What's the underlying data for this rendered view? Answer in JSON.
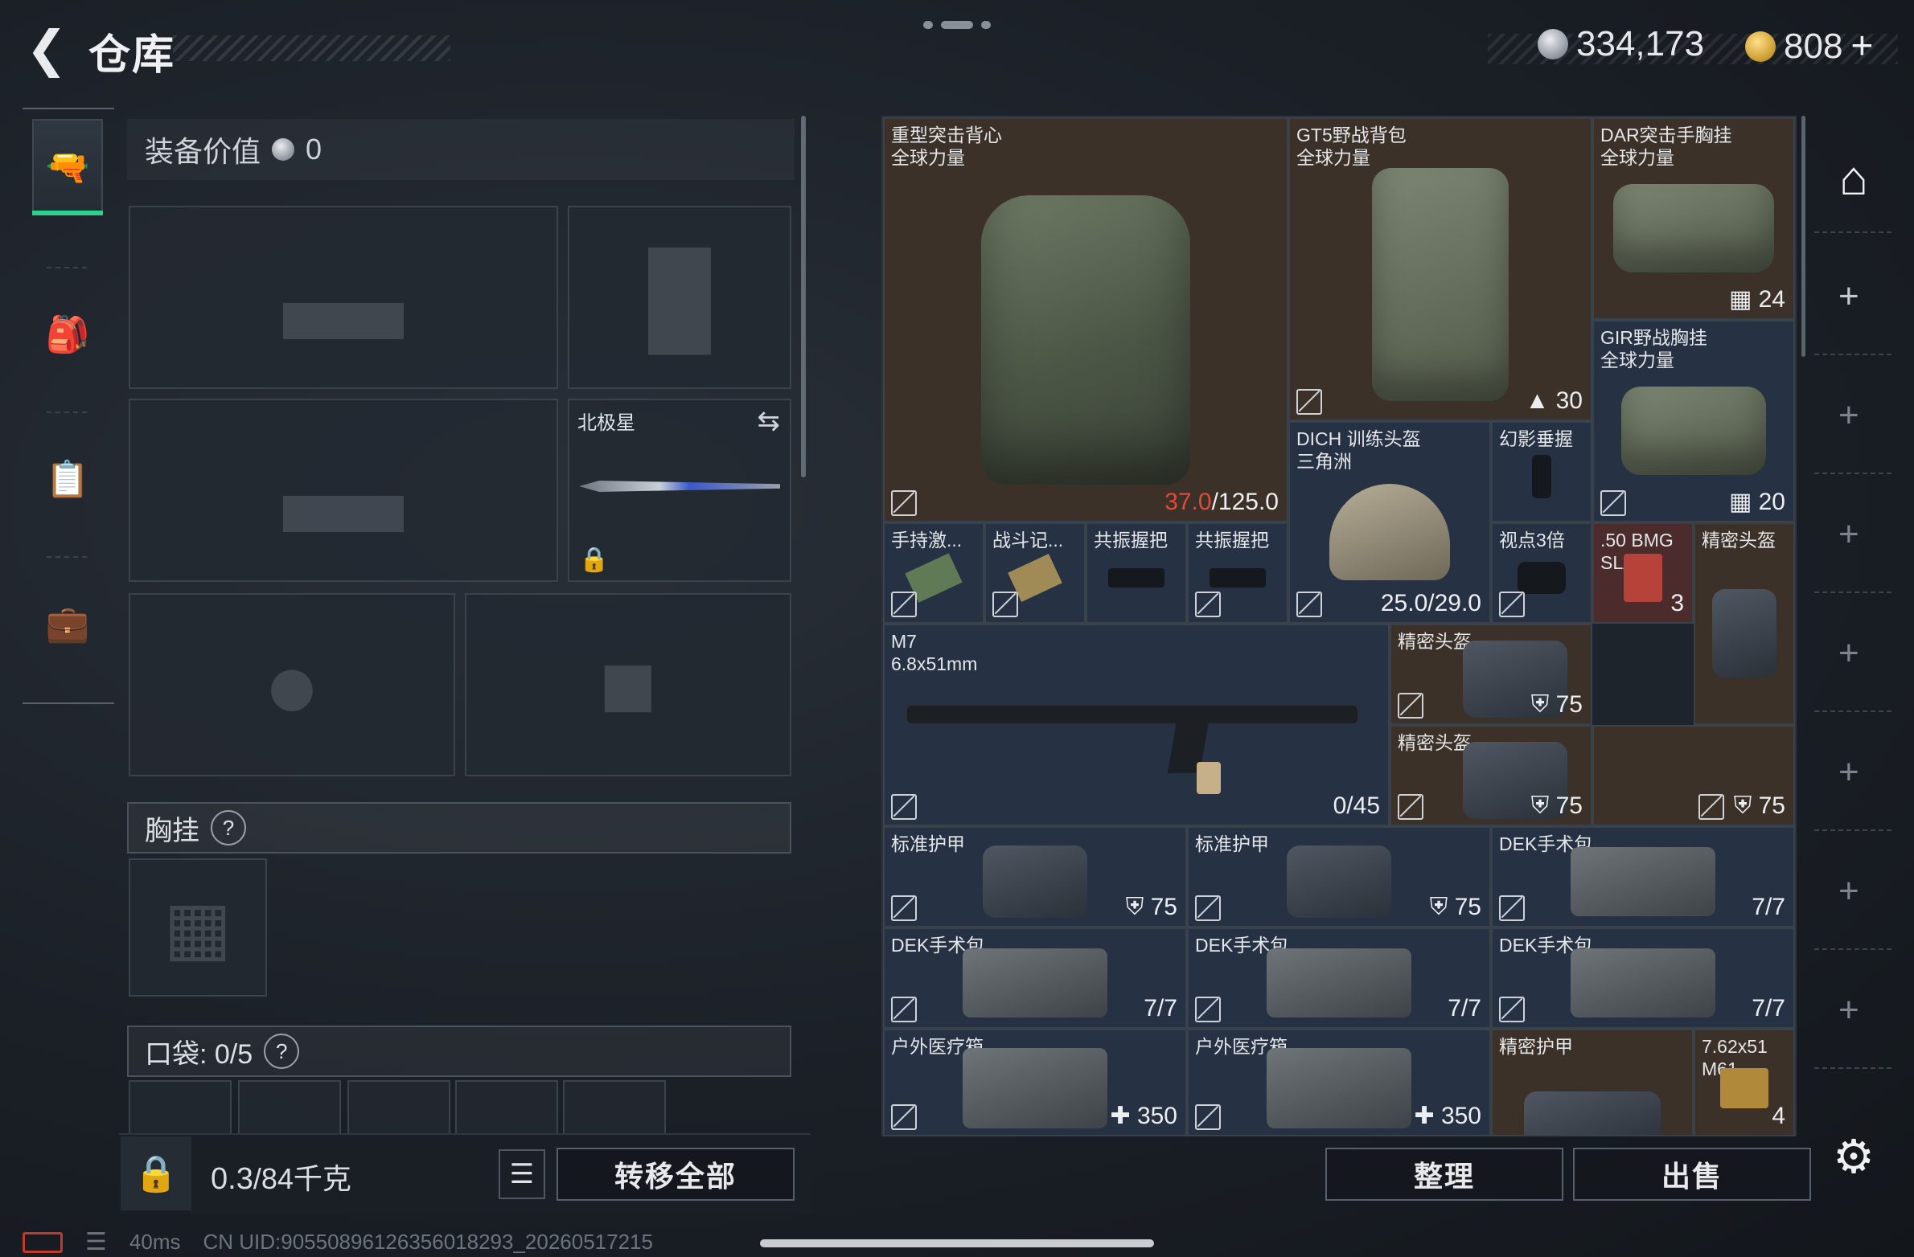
{
  "header": {
    "title": "仓库",
    "currency_silver": "334,173",
    "currency_gold": "808"
  },
  "left": {
    "equip_value_label": "装备价值",
    "equip_value": "0",
    "melee_slot_name": "北极星",
    "rig_section": "胸挂",
    "pocket_section": "口袋: 0/5",
    "weight_current": "0.3",
    "weight_max": "/84千克",
    "transfer_all": "转移全部"
  },
  "grid_items": [
    {
      "name": "重型突击背心\n全球力量",
      "value_red": "37.0",
      "value": "/125.0"
    },
    {
      "name": "GT5野战背包\n全球力量",
      "value": "30"
    },
    {
      "name": "DAR突击手胸挂\n全球力量",
      "value": "24"
    },
    {
      "name": "GIR野战胸挂\n全球力量",
      "value": "20"
    },
    {
      "name": "DICH 训练头盔\n三角洲",
      "value": "25.0/29.0"
    },
    {
      "name": "幻影垂握"
    },
    {
      "name": "手持激..."
    },
    {
      "name": "战斗记..."
    },
    {
      "name": "共振握把"
    },
    {
      "name": "共振握把"
    },
    {
      "name": "视点3倍"
    },
    {
      "name": ".50 BMG\nSLAP",
      "value": "3"
    },
    {
      "name": "精密头盔"
    },
    {
      "name": "M7\n6.8x51mm",
      "value": "0/45"
    },
    {
      "name": "精密头盔",
      "value": "75"
    },
    {
      "name": "精密头盔",
      "value": "75"
    },
    {
      "value": "75"
    },
    {
      "name": "标准护甲",
      "value": "75"
    },
    {
      "name": "标准护甲",
      "value": "75"
    },
    {
      "name": "DEK手术包",
      "value": "7/7"
    },
    {
      "name": "DEK手术包",
      "value": "7/7"
    },
    {
      "name": "DEK手术包",
      "value": "7/7"
    },
    {
      "name": "DEK手术包",
      "value": "7/7"
    },
    {
      "name": "户外医疗箱",
      "value": "350"
    },
    {
      "name": "户外医疗箱",
      "value": "350"
    },
    {
      "name": "精密护甲"
    },
    {
      "name": "7.62x51\nM61",
      "value": "4"
    }
  ],
  "buttons": {
    "sort": "整理",
    "sell": "出售"
  },
  "footer": {
    "ping": "40ms",
    "uid": "CN UID:9055089612635601829​3_20260517215"
  }
}
